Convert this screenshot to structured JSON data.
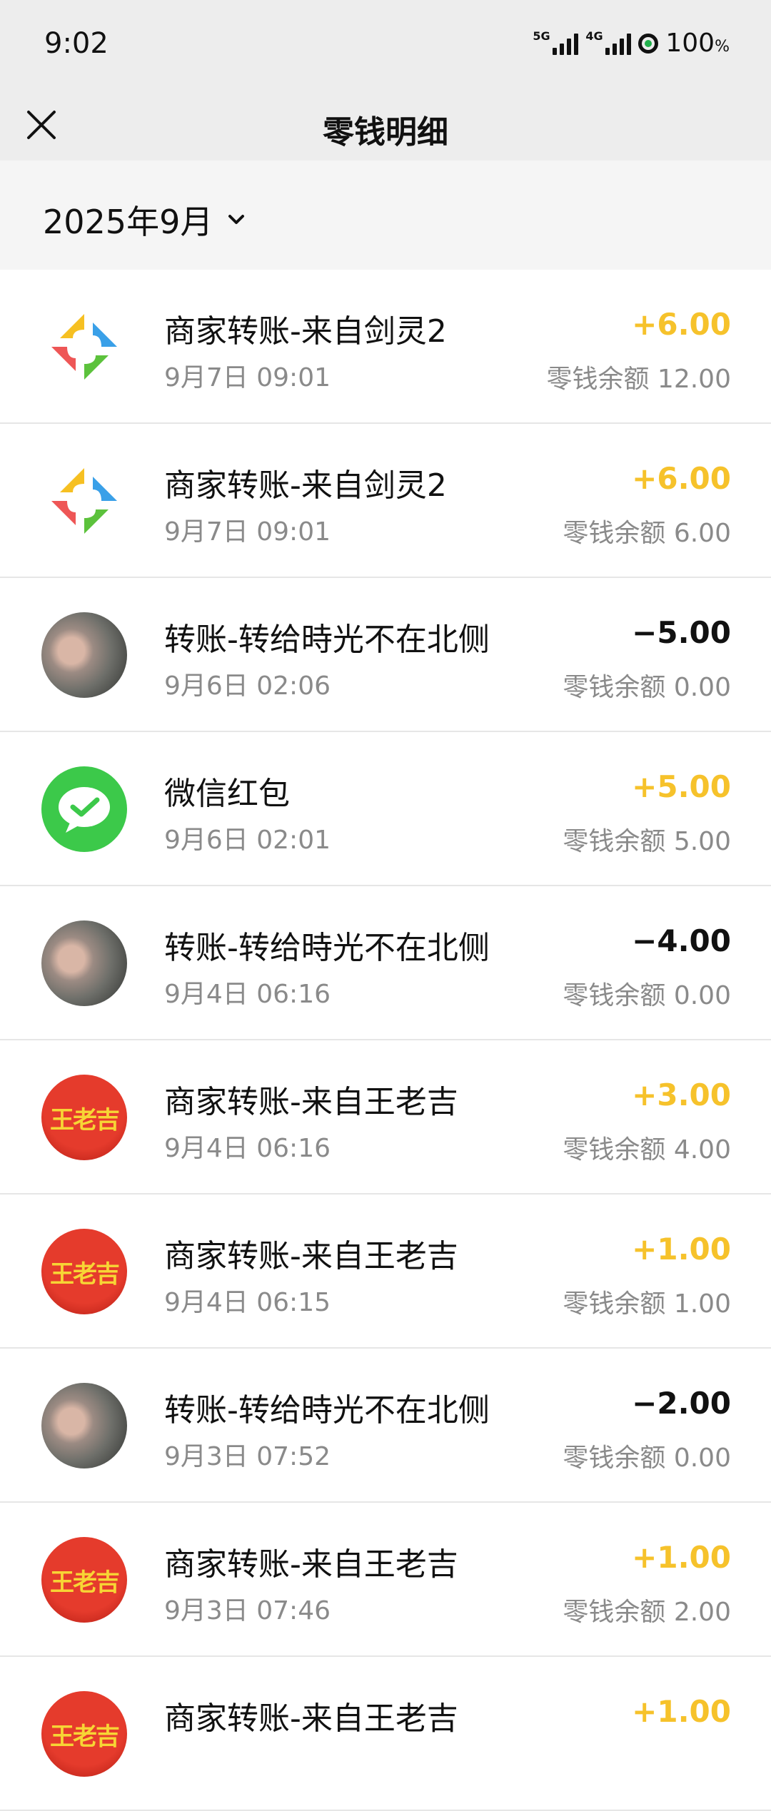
{
  "status_bar": {
    "time": "9:02",
    "signal1_label": "5G",
    "signal2_label": "4G",
    "battery": "100",
    "battery_unit": "%"
  },
  "header": {
    "title": "零钱明细"
  },
  "filter": {
    "month": "2025年9月"
  },
  "colors": {
    "income": "#f6c22b",
    "expense": "#111111",
    "wechat_green": "#3cc94a",
    "header_bg": "#ededed"
  },
  "transactions": [
    {
      "icon": "merchant-logo-icon",
      "title": "商家转账-来自剑灵2",
      "time": "9月7日 09:01",
      "amount": "+6.00",
      "balance": "零钱余额 12.00"
    },
    {
      "icon": "merchant-logo-icon",
      "title": "商家转账-来自剑灵2",
      "time": "9月7日 09:01",
      "amount": "+6.00",
      "balance": "零钱余额 6.00"
    },
    {
      "icon": "user-avatar",
      "title": "转账-转给時光不在北侧",
      "time": "9月6日 02:06",
      "amount": "−5.00",
      "balance": "零钱余额 0.00"
    },
    {
      "icon": "wechat-icon",
      "title": "微信红包",
      "time": "9月6日 02:01",
      "amount": "+5.00",
      "balance": "零钱余额 5.00"
    },
    {
      "icon": "user-avatar",
      "title": "转账-转给時光不在北侧",
      "time": "9月4日 06:16",
      "amount": "−4.00",
      "balance": "零钱余额 0.00"
    },
    {
      "icon": "wanglaoji-logo",
      "logo_text": "王老吉",
      "title": "商家转账-来自王老吉",
      "time": "9月4日 06:16",
      "amount": "+3.00",
      "balance": "零钱余额 4.00"
    },
    {
      "icon": "wanglaoji-logo",
      "logo_text": "王老吉",
      "title": "商家转账-来自王老吉",
      "time": "9月4日 06:15",
      "amount": "+1.00",
      "balance": "零钱余额 1.00"
    },
    {
      "icon": "user-avatar",
      "title": "转账-转给時光不在北侧",
      "time": "9月3日 07:52",
      "amount": "−2.00",
      "balance": "零钱余额 0.00"
    },
    {
      "icon": "wanglaoji-logo",
      "logo_text": "王老吉",
      "title": "商家转账-来自王老吉",
      "time": "9月3日 07:46",
      "amount": "+1.00",
      "balance": "零钱余额 2.00"
    },
    {
      "icon": "wanglaoji-logo",
      "logo_text": "王老吉",
      "title": "商家转账-来自王老吉",
      "time": "",
      "amount": "+1.00",
      "balance": ""
    }
  ]
}
